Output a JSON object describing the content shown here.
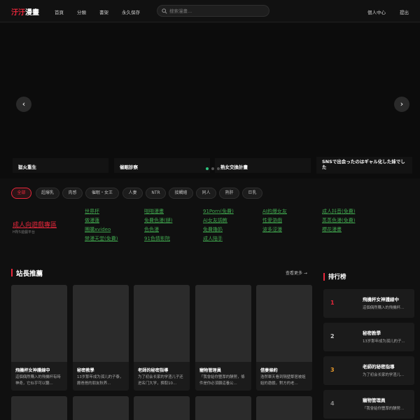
{
  "header": {
    "logo_part1": "汙汙",
    "logo_part2": "漫畫",
    "nav": [
      "首頁",
      "分類",
      "書架",
      "永久保存"
    ],
    "search_placeholder": "搜索漫畫...",
    "user_center": "個人中心",
    "logout": "提出"
  },
  "carousel": {
    "prev_arrow": "‹",
    "next_arrow": "›",
    "captions": [
      "獄火重生",
      "催眠診察",
      "熟女交換計畫",
      "SNSで出会ったのはギャル化した妹でした"
    ],
    "dot_count": 3,
    "active_dot": 0
  },
  "tags": [
    "全部",
    "超爆乳",
    "肉感",
    "催眠・女王",
    "人妻",
    "NTR",
    "接觸繪",
    "同人",
    "熟肝",
    "巨乳"
  ],
  "feature": {
    "title": "成人向遊戲專區",
    "subtitle": "H所5遊戲平台"
  },
  "links": {
    "col1": [
      "世界杯",
      "做漫蓮",
      "團購xvideo",
      "禁漫天堂(免費)"
    ],
    "col2": [
      "啪啪漫畫",
      "免費色漫(鏈)",
      "色色漫",
      "91色情影院"
    ],
    "col3": [
      "91Porn(免費)",
      "AI女友調教",
      "免費擼奶",
      "成人陪手"
    ],
    "col4": [
      "AI約爆女友",
      "性愛游戲",
      "波多涩瀑"
    ],
    "col5": [
      "成人抖音(免費)",
      "蒸蒸色漫(免費)",
      "櫻花漫畫"
    ]
  },
  "recommend": {
    "title": "站長推薦",
    "more": "查看更多 →",
    "cards": [
      {
        "title": "飛機杯女神護線中",
        "desc": "這個偶然購入的飛機杯有時神奇，它似乎可以聽..."
      },
      {
        "title": "秘密教學",
        "desc": "13岁那年成为孤儿的子泰，搬爸爸的朋友秋养..."
      },
      {
        "title": "老師的秘密指導",
        "desc": "为了初会长家的学渣儿子还进名门大学，换取10..."
      },
      {
        "title": "寵物管理員",
        "desc": "「我會給你豐厚的酬勞，條件是你必須願這養公..."
      },
      {
        "title": "借妻條約",
        "desc": "浩然單天看到隔壁鄰居被姐姐的邀戲，對方的老..."
      }
    ]
  },
  "ranking": {
    "title": "排行榜",
    "items": [
      {
        "num": "1",
        "title": "飛機杯女神護線中",
        "desc": "這個偶然購入的飛機杯..."
      },
      {
        "num": "2",
        "title": "秘密教學",
        "desc": "13岁那年成为孤儿的子..."
      },
      {
        "num": "3",
        "title": "老師的秘密指導",
        "desc": "为了初会长家的学渣儿..."
      },
      {
        "num": "4",
        "title": "寵物管理員",
        "desc": "「我會給你豐厚的酬勞..."
      }
    ],
    "num_colors": [
      "#e8273b",
      "#cccccc",
      "#e89a2b",
      "#888888"
    ]
  },
  "colors": {
    "accent": "#e8273b",
    "link_green": "#3fa34d",
    "dot_active": "#2ec27e"
  }
}
